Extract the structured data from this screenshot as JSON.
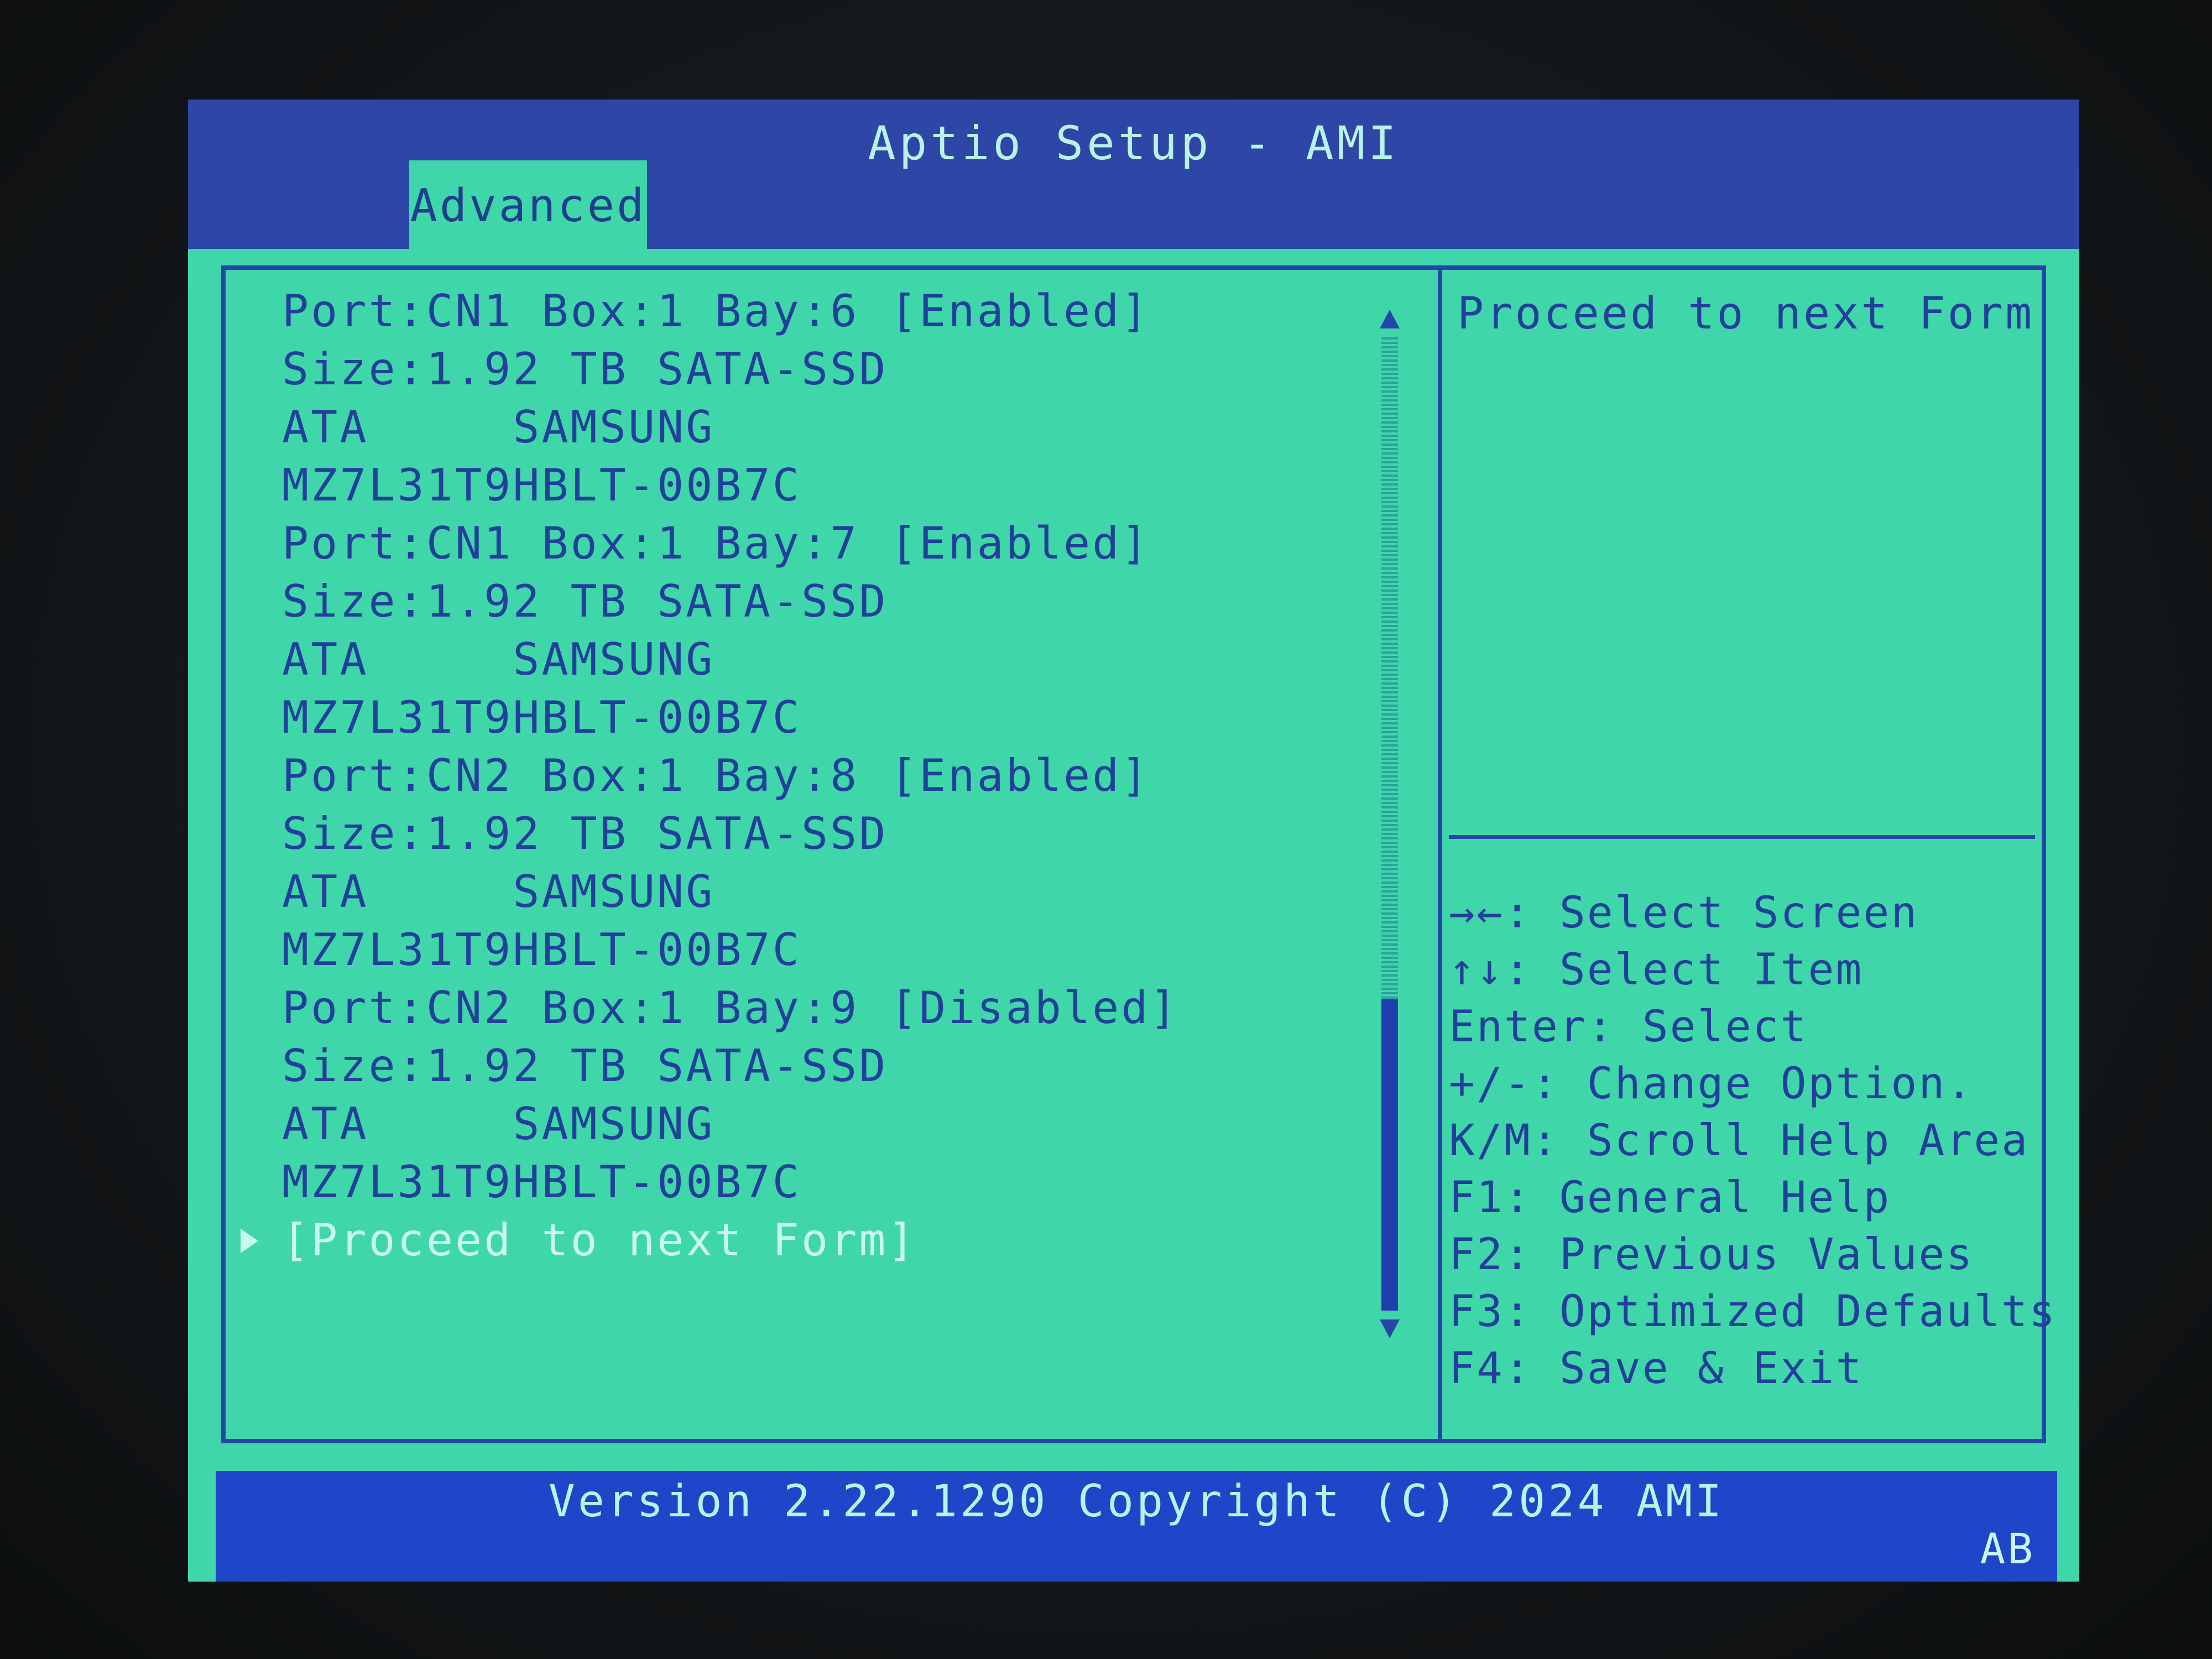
{
  "window": {
    "title": "Aptio Setup - AMI"
  },
  "tabs": [
    {
      "label": "Advanced",
      "active": true
    }
  ],
  "devices": [
    {
      "lines": [
        {
          "text": "Port:CN1 Box:1 Bay:6",
          "value": "[Enabled]"
        },
        {
          "text": "Size:1.92 TB SATA-SSD",
          "value": ""
        },
        {
          "text": "ATA     SAMSUNG",
          "value": ""
        },
        {
          "text": "MZ7L31T9HBLT-00B7C",
          "value": ""
        }
      ]
    },
    {
      "lines": [
        {
          "text": "Port:CN1 Box:1 Bay:7",
          "value": "[Enabled]"
        },
        {
          "text": "Size:1.92 TB SATA-SSD",
          "value": ""
        },
        {
          "text": "ATA     SAMSUNG",
          "value": ""
        },
        {
          "text": "MZ7L31T9HBLT-00B7C",
          "value": ""
        }
      ]
    },
    {
      "lines": [
        {
          "text": "Port:CN2 Box:1 Bay:8",
          "value": "[Enabled]"
        },
        {
          "text": "Size:1.92 TB SATA-SSD",
          "value": ""
        },
        {
          "text": "ATA     SAMSUNG",
          "value": ""
        },
        {
          "text": "MZ7L31T9HBLT-00B7C",
          "value": ""
        }
      ]
    },
    {
      "lines": [
        {
          "text": "Port:CN2 Box:1 Bay:9",
          "value": "[Disabled]"
        },
        {
          "text": "Size:1.92 TB SATA-SSD",
          "value": ""
        },
        {
          "text": "ATA     SAMSUNG",
          "value": ""
        },
        {
          "text": "MZ7L31T9HBLT-00B7C",
          "value": ""
        }
      ]
    }
  ],
  "proceed_item": {
    "label": "[Proceed to next Form]",
    "selected": true
  },
  "scrollbar": {
    "position_fraction": 0.68,
    "visible_fraction": 0.32
  },
  "help": {
    "text": "Proceed to next Form"
  },
  "keys": [
    "→←: Select Screen",
    "↑↓: Select Item",
    "Enter: Select",
    "+/-: Change Option.",
    "K/M: Scroll Help Area",
    "F1: General Help",
    "F2: Previous Values",
    "F3: Optimized Defaults",
    "F4: Save & Exit"
  ],
  "footer": {
    "version": "Version 2.22.1290 Copyright (C) 2024 AMI",
    "badge": "AB"
  },
  "colors": {
    "background": "#3fd7a9",
    "title_bar": "#2e46a6",
    "text": "#22409a",
    "highlight_text": "#c9f7ee",
    "footer": "#1f45c8"
  }
}
